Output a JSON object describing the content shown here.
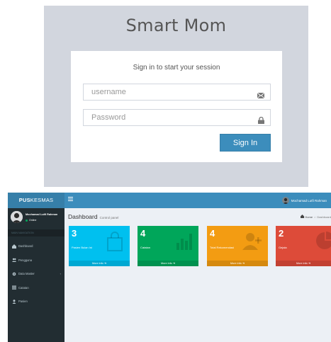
{
  "login": {
    "brand": "Smart Mom",
    "message": "Sign in to start your session",
    "username_placeholder": "username",
    "password_placeholder": "Password",
    "signin_label": "Sign In"
  },
  "dashboard": {
    "logo_bold": "PUS",
    "logo_rest": "KESMAS",
    "top_user": "Mochamad Lutfi Rahman",
    "sidebar": {
      "user_name": "Mochamad Lutfi Rahman",
      "status": "Online",
      "menu_header": "MAIN NAVIGATION",
      "items": [
        {
          "label": "Dashboard",
          "icon": "dashboard-icon"
        },
        {
          "label": "Pengguna",
          "icon": "users-icon"
        },
        {
          "label": "Data Master",
          "icon": "gear-icon"
        },
        {
          "label": "Catatan",
          "icon": "list-icon"
        },
        {
          "label": "Pasien",
          "icon": "user-icon"
        }
      ]
    },
    "header": {
      "title": "Dashboard",
      "subtitle": "Control panel",
      "crumb_home": "Home",
      "crumb_current": "Dashboard"
    },
    "stats": [
      {
        "number": "3",
        "label": "Pasien Bulan Ini",
        "footer": "More info",
        "color": "#00c0ef",
        "icon": "bag-icon"
      },
      {
        "number": "4",
        "label": "Catatan",
        "footer": "More info",
        "color": "#00a65a",
        "icon": "bar-chart-icon"
      },
      {
        "number": "4",
        "label": "Total Rekomendasi",
        "footer": "More info",
        "color": "#f39c12",
        "icon": "user-add-icon"
      },
      {
        "number": "2",
        "label": "Gejala",
        "footer": "More info",
        "color": "#dd4b39",
        "icon": "pie-chart-icon"
      }
    ],
    "colors": {
      "navbar": "#3c8dbc",
      "logo": "#367fa9",
      "sidebar": "#222d32",
      "content": "#ecf0f5"
    }
  }
}
